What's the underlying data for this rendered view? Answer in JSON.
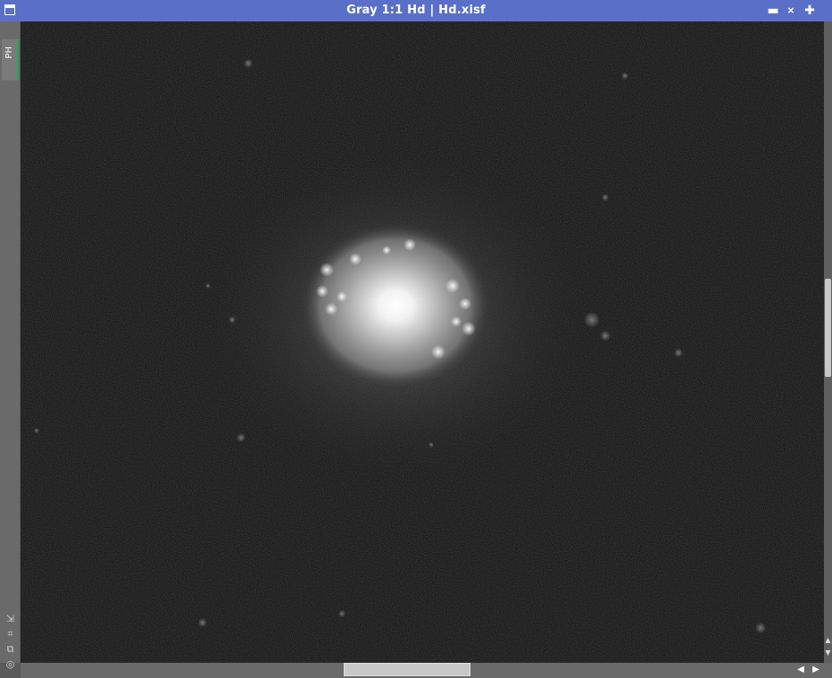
{
  "window": {
    "title": "Gray 1:1 Hd | Hd.xisf"
  },
  "titlebar_buttons": {
    "minimize": "▬",
    "shade": "⨯",
    "maximize": "✚",
    "close": "✖"
  },
  "side_panel": {
    "tab_label": "PH",
    "icons": [
      "zoom-to-fit-icon",
      "fit-window-icon",
      "clone-icon",
      "preview-icon"
    ]
  },
  "scroll_glyphs": {
    "up": "▲",
    "down": "▼",
    "left": "◀",
    "right": "▶"
  },
  "colors": {
    "titlebar": "#5a6fc8",
    "panel": "#6a6a6a",
    "canvas": "#0f0f0f",
    "active_tab_accent": "#22aa55"
  }
}
